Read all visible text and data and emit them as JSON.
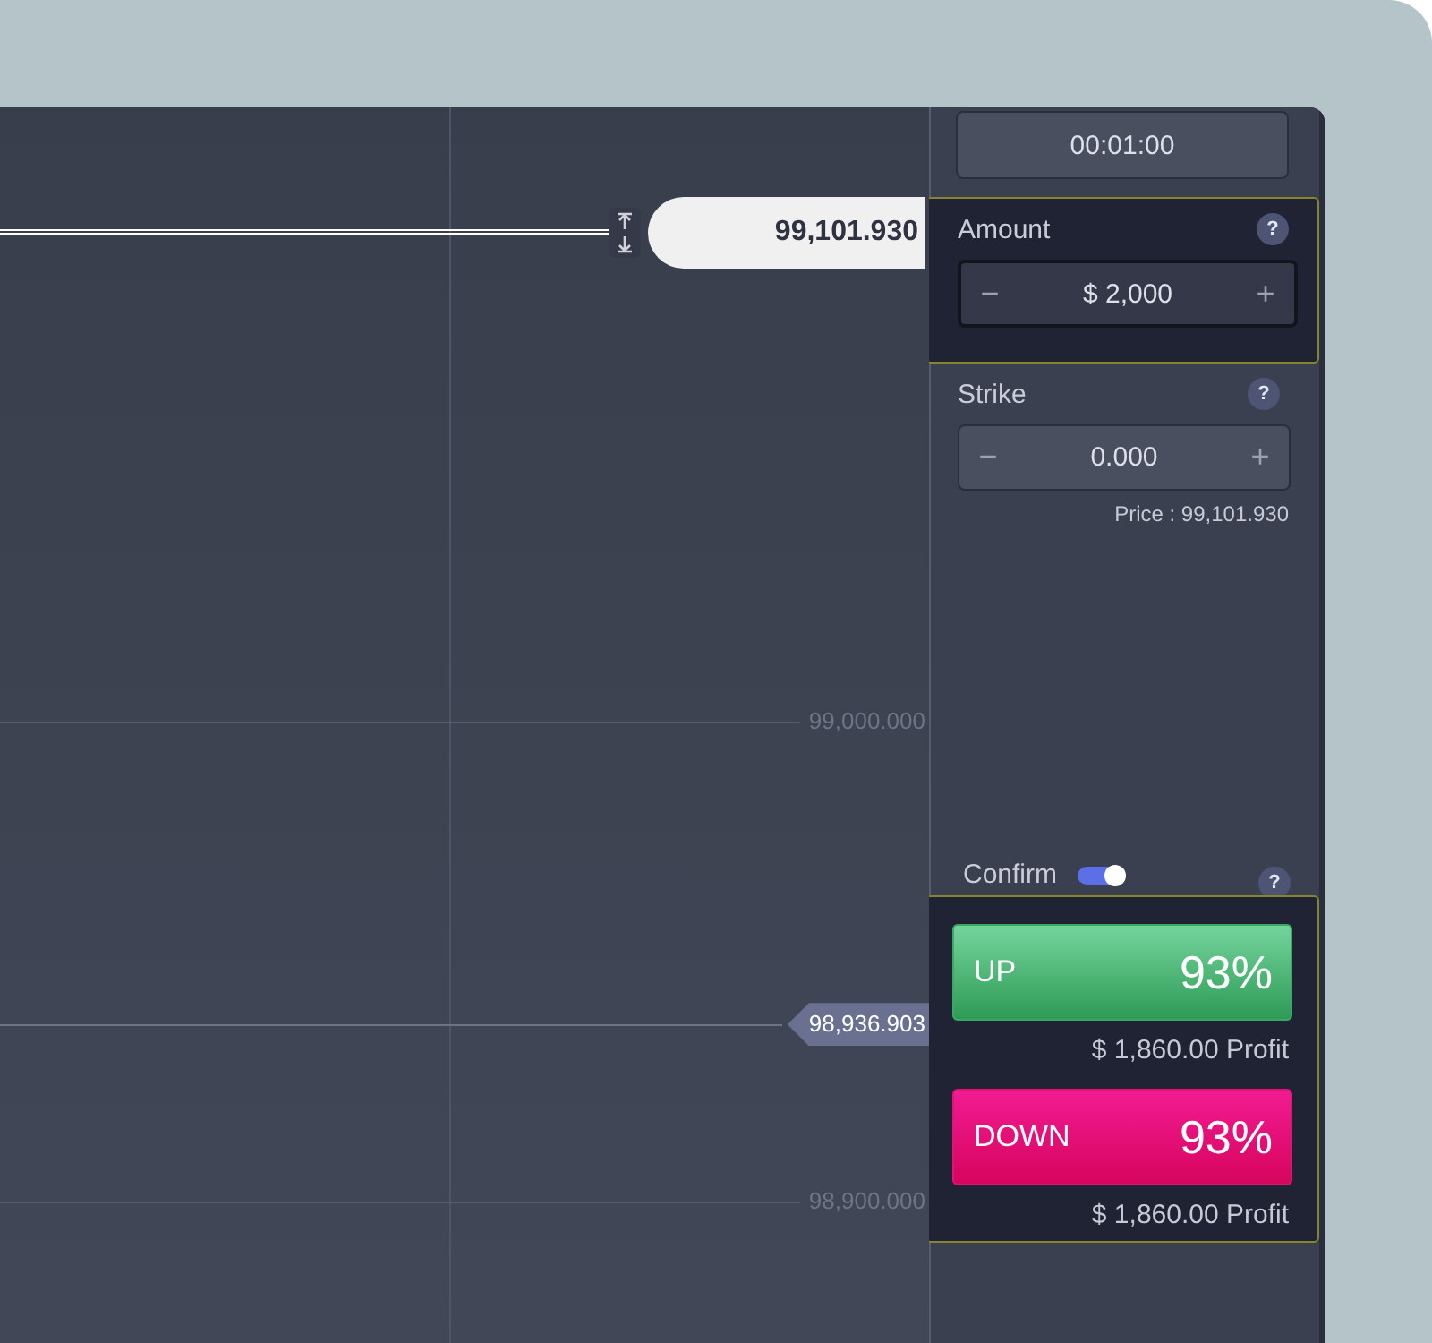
{
  "chart": {
    "current_price": {
      "label": "99,101.930"
    },
    "price_axis": [
      {
        "label": "99,000.000"
      },
      {
        "label": "98,900.000"
      }
    ],
    "price_tag": {
      "label": "98,936.903"
    }
  },
  "expiry": {
    "value": "00:01:00"
  },
  "amount": {
    "label": "Amount",
    "help": "?",
    "decrement": "−",
    "value": "$ 2,000",
    "increment": "+",
    "highlighted": true
  },
  "strike": {
    "label": "Strike",
    "help": "?",
    "decrement": "−",
    "value": "0.000",
    "increment": "+",
    "price_note": "Price : 99,101.930"
  },
  "confirm": {
    "label": "Confirm",
    "on": true,
    "help": "?"
  },
  "trade_panel": {
    "highlighted": true,
    "options": [
      {
        "kind": "up",
        "label": "UP",
        "payout": "93%",
        "profit": "$ 1,860.00 Profit"
      },
      {
        "kind": "down",
        "label": "DOWN",
        "payout": "93%",
        "profit": "$ 1,860.00 Profit"
      }
    ]
  }
}
